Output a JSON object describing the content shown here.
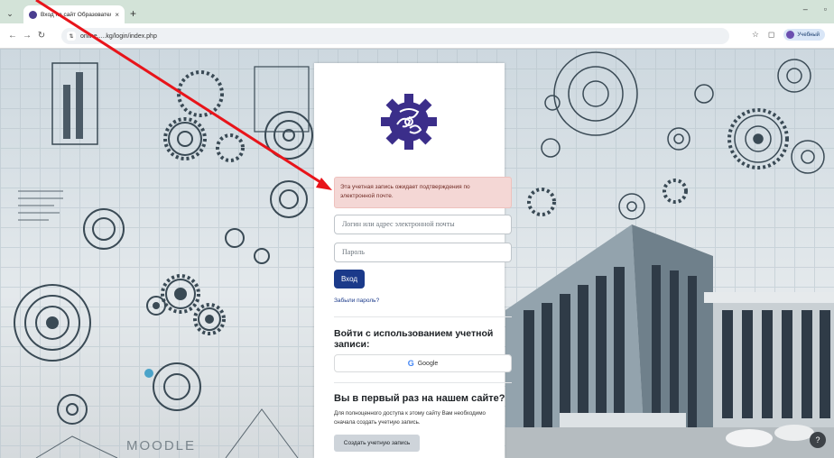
{
  "browser": {
    "tab_title": "Вход на сайт Образовательн...",
    "tab_close": "×",
    "new_tab": "+",
    "url": "online.....kg/login/index.php",
    "profile_label": "Учебный",
    "win_minimize": "–",
    "win_maximize": "▫",
    "icons": [
      "menu-icon",
      "back-icon",
      "forward-icon",
      "reload-icon",
      "site-info-icon",
      "bookmark-star-icon",
      "extensions-icon"
    ]
  },
  "background": {
    "moodle_text": "MOODLE"
  },
  "login": {
    "alert_text": "Эта учетная запись ожидает подтверждения по электронной почте.",
    "username_placeholder": "Логин или адрес электронной почты",
    "password_placeholder": "Пароль",
    "login_button": "Вход",
    "forgot_link": "Забыли пароль?",
    "alt_login_heading": "Войти с использованием учетной записи:",
    "google_button": "Google",
    "first_time_heading": "Вы в первый раз на нашем сайте?",
    "first_time_text": "Для полноценного доступа к этому сайту Вам необходимо сначала создать учетную запись.",
    "create_account_button": "Создать учетную запись"
  },
  "help_button": "?",
  "colors": {
    "primary": "#1b3a8a",
    "alert_bg": "#f4d7d5",
    "logo": "#3b2e8a",
    "annotation_arrow": "#e8141a"
  }
}
